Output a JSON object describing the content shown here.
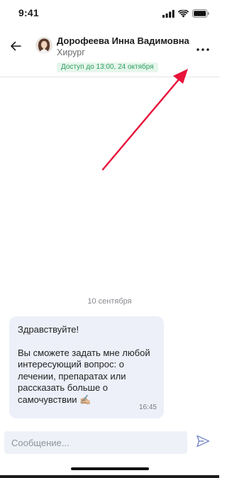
{
  "status_bar": {
    "time": "9:41"
  },
  "header": {
    "contact_name": "Дорофеева Инна Вадимовна",
    "contact_role": "Хирург",
    "access_badge": "Доступ до 13:00, 24 октября"
  },
  "chat": {
    "date_separator": "10 сентября",
    "messages": [
      {
        "greeting": "Здравствуйте!",
        "text": "Вы сможете задать мне любой интересующий вопрос: о лечении, препаратах или рассказать больше о самочувствии ✍🏼",
        "time": "16:45"
      }
    ]
  },
  "composer": {
    "placeholder": "Сообщение..."
  },
  "colors": {
    "badge_background": "#e6f6ec",
    "badge_text": "#2a9d5c",
    "bubble_background": "#edf0f9",
    "send_icon": "#7b8bc9",
    "annotation_arrow": "#e8123a"
  },
  "icons": {
    "back": "arrow-left-icon",
    "more": "more-dots-icon",
    "send": "send-icon",
    "signal": "signal-icon",
    "wifi": "wifi-icon",
    "battery": "battery-icon"
  }
}
